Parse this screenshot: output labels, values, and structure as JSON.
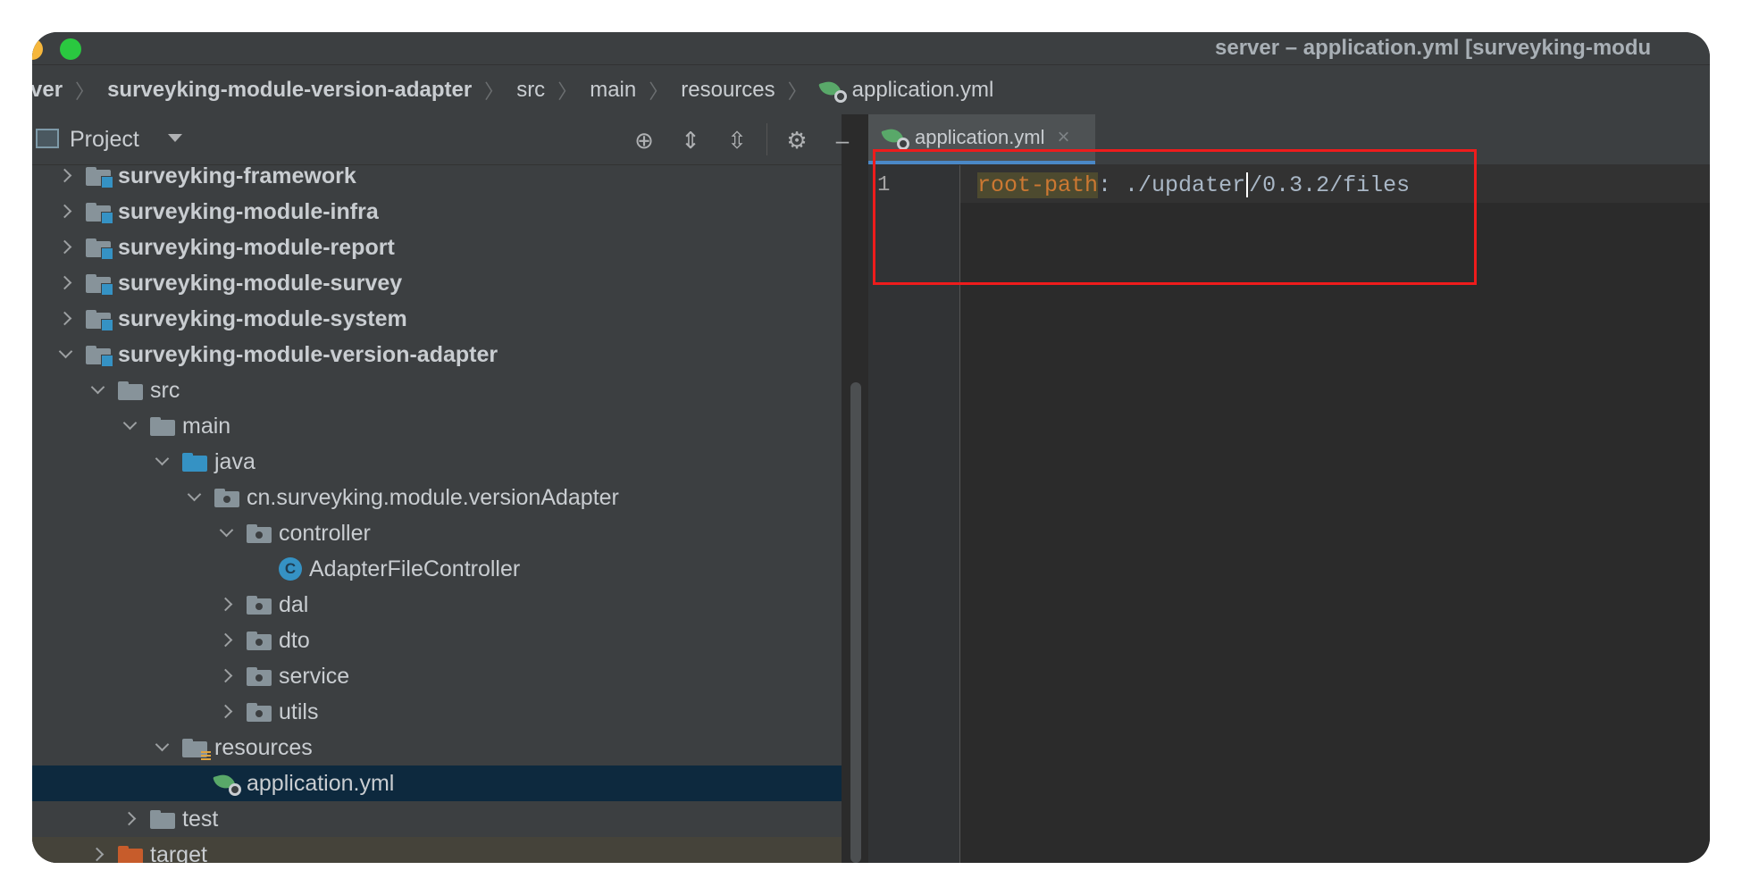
{
  "window": {
    "title": "server – application.yml [surveyking-modu"
  },
  "breadcrumb": {
    "items": [
      "ver",
      "surveyking-module-version-adapter",
      "src",
      "main",
      "resources",
      "application.yml"
    ]
  },
  "project_panel": {
    "title": "Project",
    "tree": [
      {
        "label": "surveyking-framework",
        "state": "collapsed",
        "icon": "module-folder-icon",
        "bold": true
      },
      {
        "label": "surveyking-module-infra",
        "state": "collapsed",
        "icon": "module-folder-icon",
        "bold": true
      },
      {
        "label": "surveyking-module-report",
        "state": "collapsed",
        "icon": "module-folder-icon",
        "bold": true
      },
      {
        "label": "surveyking-module-survey",
        "state": "collapsed",
        "icon": "module-folder-icon",
        "bold": true
      },
      {
        "label": "surveyking-module-system",
        "state": "collapsed",
        "icon": "module-folder-icon",
        "bold": true
      },
      {
        "label": "surveyking-module-version-adapter",
        "state": "expanded",
        "icon": "module-folder-icon",
        "bold": true
      },
      {
        "label": "src",
        "state": "expanded",
        "icon": "folder-icon"
      },
      {
        "label": "main",
        "state": "expanded",
        "icon": "folder-icon"
      },
      {
        "label": "java",
        "state": "expanded",
        "icon": "source-folder-icon"
      },
      {
        "label": "cn.surveyking.module.versionAdapter",
        "state": "expanded",
        "icon": "package-icon"
      },
      {
        "label": "controller",
        "state": "expanded",
        "icon": "package-icon"
      },
      {
        "label": "AdapterFileController",
        "state": "leaf",
        "icon": "class-icon"
      },
      {
        "label": "dal",
        "state": "collapsed",
        "icon": "package-icon"
      },
      {
        "label": "dto",
        "state": "collapsed",
        "icon": "package-icon"
      },
      {
        "label": "service",
        "state": "collapsed",
        "icon": "package-icon"
      },
      {
        "label": "utils",
        "state": "collapsed",
        "icon": "package-icon"
      },
      {
        "label": "resources",
        "state": "expanded",
        "icon": "resources-folder-icon"
      },
      {
        "label": "application.yml",
        "state": "leaf",
        "icon": "spring-yml-icon",
        "selected": true
      },
      {
        "label": "test",
        "state": "collapsed",
        "icon": "folder-icon"
      },
      {
        "label": "target",
        "state": "collapsed",
        "icon": "excluded-folder-icon"
      }
    ]
  },
  "editor": {
    "tab_label": "application.yml",
    "line_number": "1",
    "code_key": "root-path",
    "code_colon": ":",
    "code_value_before_caret": " ./updater",
    "code_value_after_caret": "/0.3.2/files"
  },
  "colors": {
    "annotation_box": "#ee1c1c",
    "selection": "#0d293e",
    "yaml_key": "#cc7832",
    "tab_underline": "#4a88c7"
  }
}
